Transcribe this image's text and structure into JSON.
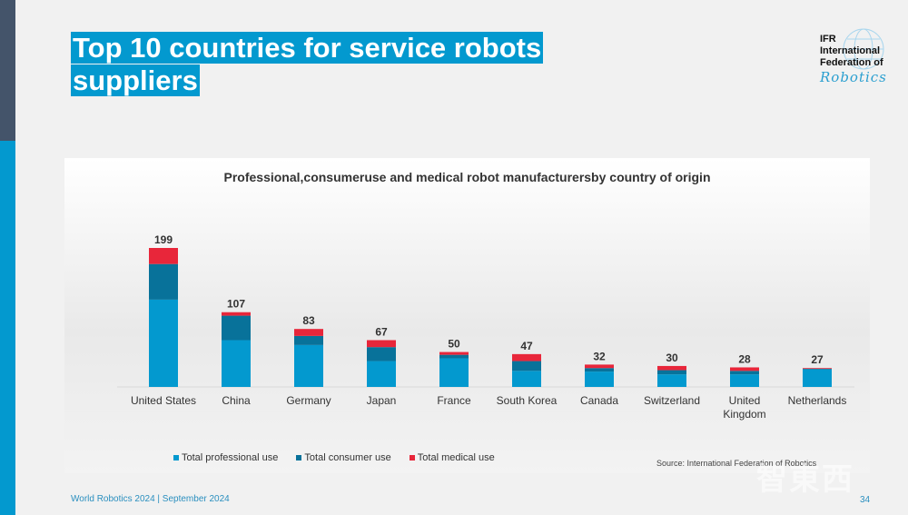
{
  "slide": {
    "title_line1": "Top 10 countries for service robots",
    "title_line2": "suppliers",
    "logo": {
      "line1": "IFR",
      "line2": "International",
      "line3": "Federation of",
      "line4": "Robotics"
    },
    "source": "Source: International Federation of Robotics",
    "footer": "World Robotics 2024  | September 2024",
    "page_number": "34",
    "watermark": "智東西",
    "colors": {
      "brand_blue": "#0399cf",
      "sidebar_dark": "#44546a"
    }
  },
  "chart_data": {
    "type": "bar",
    "stacked": true,
    "title": "Professional,consumeruse and medical robot manufacturersby country of origin",
    "xlabel": "",
    "ylabel": "",
    "ylim": [
      0,
      220
    ],
    "grid": false,
    "legend_position": "bottom",
    "categories": [
      "United States",
      "China",
      "Germany",
      "Japan",
      "France",
      "South Korea",
      "Canada",
      "Switzerland",
      "United Kingdom",
      "Netherlands"
    ],
    "totals": [
      199,
      107,
      83,
      67,
      50,
      47,
      32,
      30,
      28,
      27
    ],
    "series": [
      {
        "name": "Total professional use",
        "color": "#0399cf",
        "values": [
          125,
          67,
          60,
          37,
          41,
          23,
          22,
          18,
          18,
          25
        ]
      },
      {
        "name": "Total consumer use",
        "color": "#08729a",
        "values": [
          51,
          35,
          13,
          20,
          5,
          14,
          5,
          6,
          5,
          1
        ]
      },
      {
        "name": "Total medical use",
        "color": "#e8263a",
        "values": [
          23,
          5,
          10,
          10,
          4,
          10,
          5,
          6,
          5,
          1
        ]
      }
    ]
  }
}
